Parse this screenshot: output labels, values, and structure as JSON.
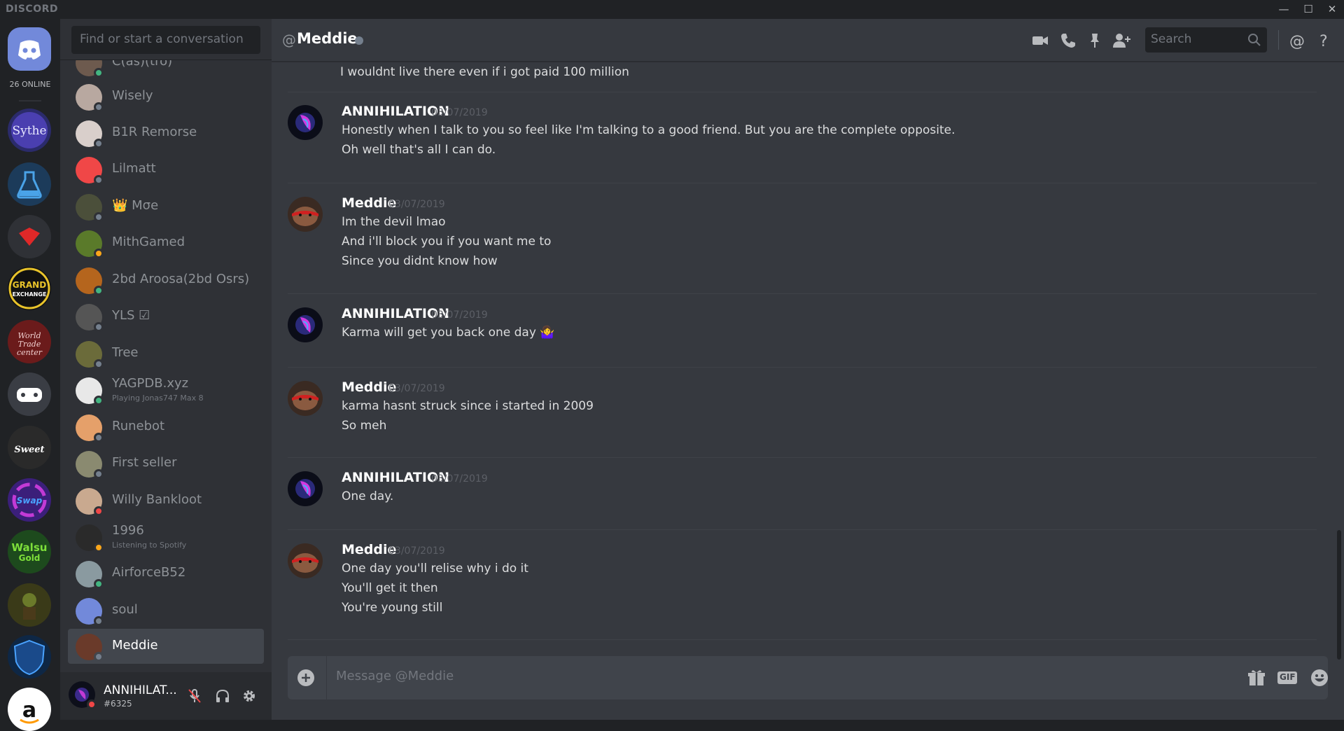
{
  "app": {
    "brand": "DISCORD"
  },
  "window_controls": [
    "minimize-icon",
    "maximize-icon",
    "close-icon"
  ],
  "guilds": {
    "online_count": "26 ONLINE",
    "items": [
      {
        "name": "Sythe",
        "color": "#2b2b6b"
      },
      {
        "name": "flask-server",
        "color": "#1c3b5a"
      },
      {
        "name": "red-gem-server",
        "color": "#2f3136"
      },
      {
        "name": "GRAND EXCHANGE",
        "color": "#111111"
      },
      {
        "name": "World Trade Center",
        "color": "#6b1b1b"
      },
      {
        "name": "gamepad-server",
        "color": "#3a3d44"
      },
      {
        "name": "SweetGold",
        "color": "#2a2a2a"
      },
      {
        "name": "Swapper",
        "color": "#3b1f7a"
      },
      {
        "name": "WalsuGold",
        "color": "#1d4a1d"
      },
      {
        "name": "goblin-server",
        "color": "#3a3a18"
      },
      {
        "name": "blue-shield-server",
        "color": "#0e2745"
      },
      {
        "name": "Amazon",
        "color": "#ffffff"
      }
    ]
  },
  "dm_sidebar": {
    "search_placeholder": "Find or start a conversation",
    "items": [
      {
        "name": "C(as)(tro)",
        "sub": "",
        "status": "#43b581",
        "avatar": "#6d5a4e",
        "selected": false
      },
      {
        "name": "Wisely",
        "sub": "",
        "status": "#747f8d",
        "avatar": "#b8a8a0",
        "selected": false
      },
      {
        "name": "B1R Remorse",
        "sub": "",
        "status": "#747f8d",
        "avatar": "#d9cfcb",
        "selected": false
      },
      {
        "name": "Lilmatt",
        "sub": "",
        "status": "#747f8d",
        "avatar": "#f04747",
        "selected": false
      },
      {
        "name": "👑 Μσe",
        "sub": "",
        "status": "#747f8d",
        "avatar": "#4b4f3a",
        "selected": false
      },
      {
        "name": "MithGamed",
        "sub": "",
        "status": "#faa61a",
        "avatar": "#5a7a2a",
        "selected": false
      },
      {
        "name": "2bd Aroosa(2bd Osrs)",
        "sub": "",
        "status": "#43b581",
        "avatar": "#b5651d",
        "selected": false
      },
      {
        "name": "YLS ☑",
        "sub": "",
        "status": "#747f8d",
        "avatar": "#555555",
        "selected": false
      },
      {
        "name": "Tree",
        "sub": "",
        "status": "#747f8d",
        "avatar": "#6b6b3a",
        "selected": false
      },
      {
        "name": "YAGPDB.xyz",
        "sub": "Playing Jonas747 Max 8",
        "status": "#43b581",
        "avatar": "#e8e8e8",
        "selected": false
      },
      {
        "name": "Runebot",
        "sub": "",
        "status": "#747f8d",
        "avatar": "#e5a06a",
        "selected": false
      },
      {
        "name": "First seller",
        "sub": "",
        "status": "#747f8d",
        "avatar": "#8a8a70",
        "selected": false
      },
      {
        "name": "Willy Bankloot",
        "sub": "",
        "status": "#f04747",
        "avatar": "#c9a98f",
        "selected": false
      },
      {
        "name": "1996",
        "sub": "Listening to Spotify",
        "status": "#faa61a",
        "avatar": "#2a2a2a",
        "selected": false
      },
      {
        "name": "AirforceB52",
        "sub": "",
        "status": "#43b581",
        "avatar": "#8a9aa0",
        "selected": false
      },
      {
        "name": "soul",
        "sub": "",
        "status": "#747f8d",
        "avatar": "#7289da",
        "selected": false
      },
      {
        "name": "Meddie",
        "sub": "",
        "status": "#747f8d",
        "avatar": "#6a3a2a",
        "selected": true
      }
    ]
  },
  "user_panel": {
    "name": "ANNIHILAT...",
    "tag": "#6325",
    "status_color": "#f04747"
  },
  "chat": {
    "at": "@",
    "channel_name": "Meddie",
    "search_placeholder": "Search",
    "cut_line": "I wouldnt live there even if i got paid 100 million",
    "messages": [
      {
        "author": "ANNIHILATION",
        "time": "03/07/2019",
        "avatar": "annihilation",
        "lines": [
          "Honestly when I talk to you so feel like I'm talking to a good friend. But you are the complete opposite.",
          "Oh well that's all I can do."
        ]
      },
      {
        "author": "Meddie",
        "time": "03/07/2019",
        "avatar": "meddie",
        "lines": [
          "Im the devil lmao",
          "And i'll block you if you want me to",
          "Since you didnt know how"
        ]
      },
      {
        "author": "ANNIHILATION",
        "time": "03/07/2019",
        "avatar": "annihilation",
        "lines": [
          "Karma will get you back one day 🤷‍♀️"
        ]
      },
      {
        "author": "Meddie",
        "time": "03/07/2019",
        "avatar": "meddie",
        "lines": [
          "karma hasnt struck since i started in 2009",
          "So meh"
        ]
      },
      {
        "author": "ANNIHILATION",
        "time": "03/07/2019",
        "avatar": "annihilation",
        "lines": [
          "One day."
        ]
      },
      {
        "author": "Meddie",
        "time": "03/07/2019",
        "avatar": "meddie",
        "lines": [
          "One day you'll relise why i do it",
          "You'll get it then",
          "You're young still"
        ]
      }
    ],
    "composer_placeholder": "Message @Meddie",
    "composer_gif": "GIF"
  },
  "colors": {
    "accent": "#7289da",
    "online": "#43b581",
    "idle": "#faa61a",
    "dnd": "#f04747",
    "offline": "#747f8d"
  }
}
